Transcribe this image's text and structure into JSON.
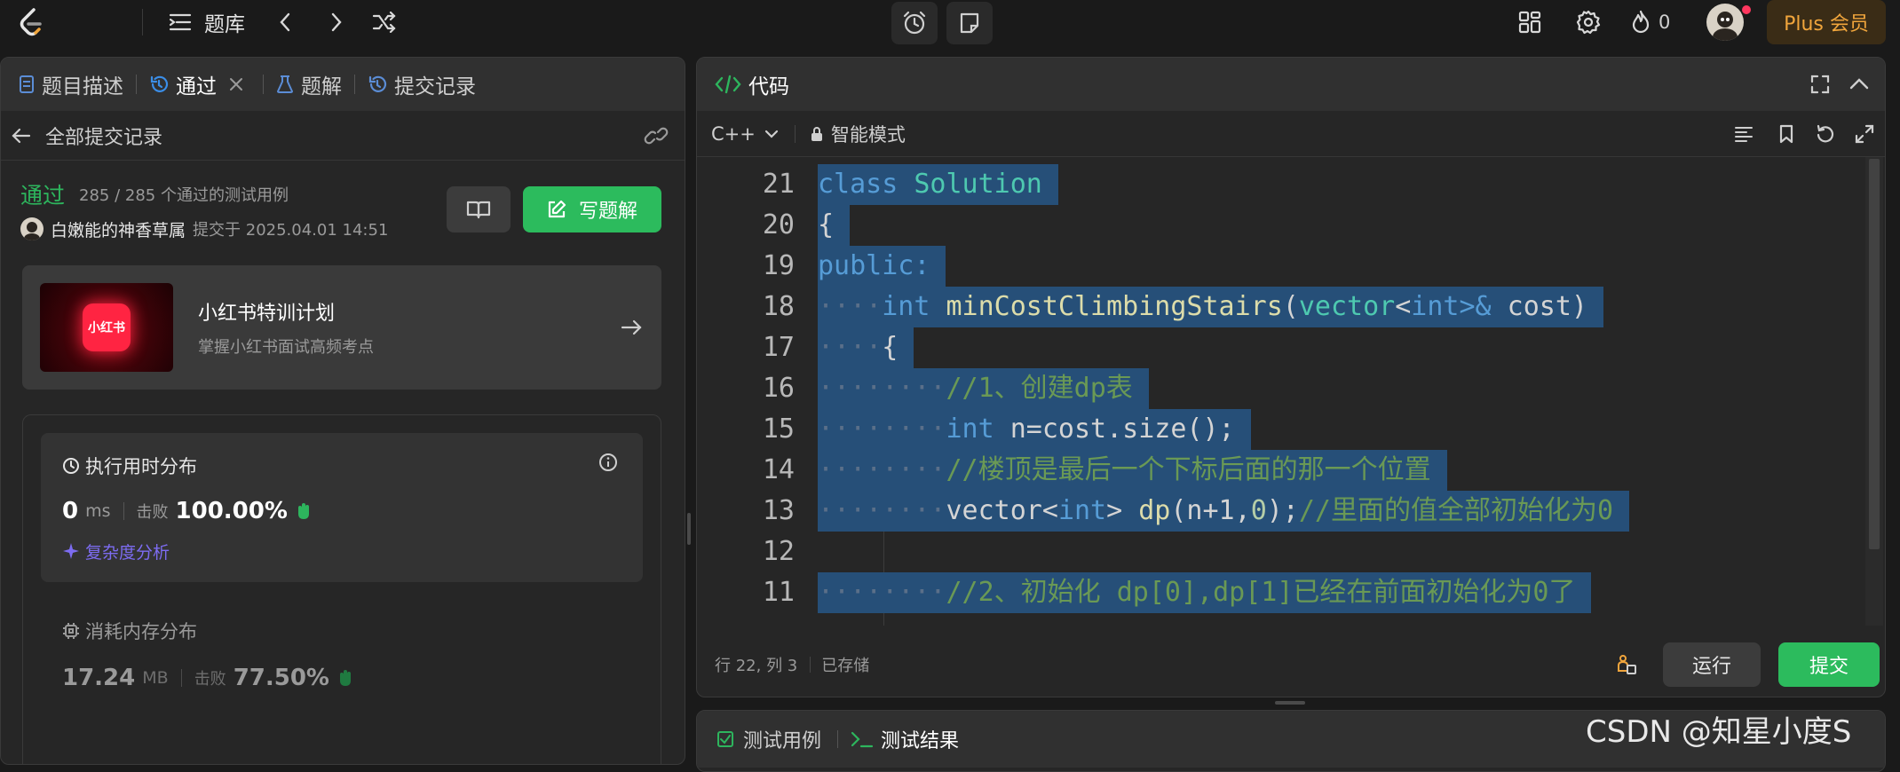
{
  "topbar": {
    "nav_label": "题库",
    "streak_count": "0",
    "plus_label": "Plus 会员"
  },
  "left_panel": {
    "tabs": [
      {
        "label": "题目描述"
      },
      {
        "label": "通过"
      },
      {
        "label": "题解"
      },
      {
        "label": "提交记录"
      }
    ],
    "back_label": "全部提交记录",
    "status": "通过",
    "tests_passed": "285 / 285 个通过的测试用例",
    "author": "白嫩能的神香草属",
    "submitted_at": "提交于 2025.04.01 14:51",
    "write_solution": "写题解",
    "promo": {
      "logo_text": "小红书",
      "title": "小红书特训计划",
      "subtitle": "掌握小红书面试高频考点"
    },
    "runtime": {
      "title": "执行用时分布",
      "value": "0",
      "unit": "ms",
      "beat_label": "击败",
      "beat_value": "100.00%",
      "complexity": "复杂度分析"
    },
    "memory": {
      "title": "消耗内存分布",
      "value": "17.24",
      "unit": "MB",
      "beat_label": "击败",
      "beat_value": "77.50%"
    }
  },
  "code_panel": {
    "title": "代码",
    "language": "C++",
    "mode": "智能模式",
    "lines": [
      {
        "num": "21",
        "indent": "",
        "text": ""
      },
      {
        "num": "20",
        "indent": "",
        "text": "{"
      },
      {
        "num": "19",
        "indent": "",
        "text": ""
      },
      {
        "num": "18",
        "indent": "····",
        "text": ""
      },
      {
        "num": "17",
        "indent": "····",
        "text": "{"
      },
      {
        "num": "16",
        "indent": "········",
        "text": "//1、创建dp表"
      },
      {
        "num": "15",
        "indent": "········",
        "text": ""
      },
      {
        "num": "14",
        "indent": "········",
        "text": "//楼顶是最后一个下标后面的那一个位置"
      },
      {
        "num": "13",
        "indent": "········",
        "text": ""
      },
      {
        "num": "12",
        "indent": "",
        "text": ""
      },
      {
        "num": "11",
        "indent": "········",
        "text": "//2、初始化 dp[0],dp[1]已经在前面初始化为0了"
      }
    ],
    "tokens": {
      "l21_kw": "class",
      "l21_ty": "Solution",
      "l19_kw": "public:",
      "l18_kw": "int",
      "l18_fn": "minCostClimbingStairs",
      "l18_p1": "(",
      "l18_ty": "vector",
      "l18_p2": "<",
      "l18_kw2": "int",
      "l18_p3": ">&",
      "l18_var": "cost",
      "l18_p4": ")",
      "l15_kw": "int",
      "l15_rest": "n=cost.size();",
      "l13_a": "vector<",
      "l13_kw": "int",
      "l13_b": ">",
      "l13_fn": "dp",
      "l13_c": "(n+1,",
      "l13_num": "0",
      "l13_d": ");",
      "l13_cm": "//里面的值全部初始化为0"
    },
    "status_position": "行 22, 列 3",
    "status_saved": "已存储",
    "run_label": "运行",
    "submit_label": "提交"
  },
  "bottom_panel": {
    "tab_testcase": "测试用例",
    "tab_result": "测试结果"
  },
  "watermark": "CSDN @知星小度S",
  "colors": {
    "accent_green": "#2cbb5d",
    "status_green": "#2db55d",
    "plus_gold": "#f0a53c",
    "selection": "#264f78",
    "link_purple": "#7d6cf2"
  }
}
